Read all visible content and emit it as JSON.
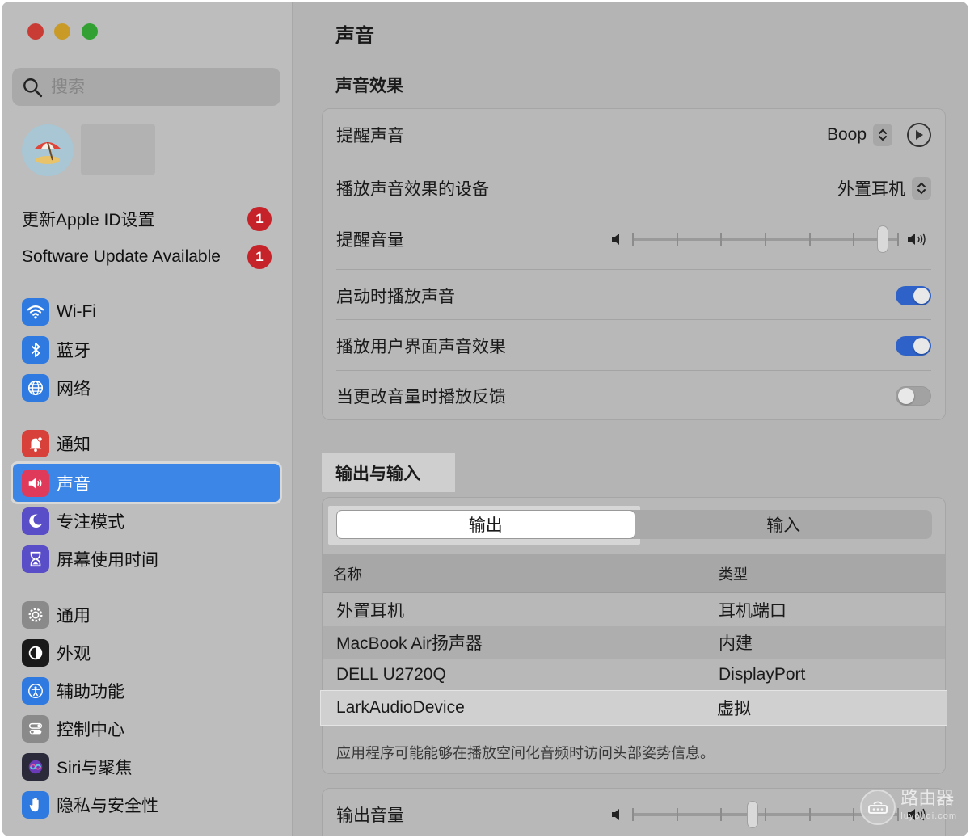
{
  "search": {
    "placeholder": "搜索"
  },
  "sidebar": {
    "updates": [
      {
        "label": "更新Apple ID设置",
        "badge": "1"
      },
      {
        "label": "Software Update Available",
        "badge": "1"
      }
    ],
    "items": [
      {
        "label": "Wi-Fi",
        "icon": "wifi-icon",
        "color": "#2f7ae0"
      },
      {
        "label": "蓝牙",
        "icon": "bluetooth-icon",
        "color": "#2f7ae0"
      },
      {
        "label": "网络",
        "icon": "globe-icon",
        "color": "#2f7ae0"
      },
      {
        "label": "通知",
        "icon": "bell-icon",
        "color": "#d8403a"
      },
      {
        "label": "声音",
        "icon": "speaker-icon",
        "color": "#e03a5a"
      },
      {
        "label": "专注模式",
        "icon": "moon-icon",
        "color": "#5a4ec8"
      },
      {
        "label": "屏幕使用时间",
        "icon": "hourglass-icon",
        "color": "#5a4ec8"
      },
      {
        "label": "通用",
        "icon": "gear-icon",
        "color": "#8a8a8a"
      },
      {
        "label": "外观",
        "icon": "appearance-icon",
        "color": "#1a1a1a"
      },
      {
        "label": "辅助功能",
        "icon": "accessibility-icon",
        "color": "#2f7ae0"
      },
      {
        "label": "控制中心",
        "icon": "control-center-icon",
        "color": "#8a8a8a"
      },
      {
        "label": "Siri与聚焦",
        "icon": "siri-icon",
        "color": "#6a3ab8"
      },
      {
        "label": "隐私与安全性",
        "icon": "hand-icon",
        "color": "#2f7ae0"
      }
    ]
  },
  "main": {
    "title": "声音",
    "sound_effects": {
      "section_title": "声音效果",
      "alert_sound": {
        "label": "提醒声音",
        "value": "Boop"
      },
      "output_device": {
        "label": "播放声音效果的设备",
        "value": "外置耳机"
      },
      "alert_volume": {
        "label": "提醒音量",
        "level": 0.96
      },
      "startup_sound": {
        "label": "启动时播放声音",
        "on": true
      },
      "ui_sound": {
        "label": "播放用户界面声音效果",
        "on": true
      },
      "volume_feedback": {
        "label": "当更改音量时播放反馈",
        "on": false
      }
    },
    "io": {
      "section_title": "输出与输入",
      "tabs": [
        "输出",
        "输入"
      ],
      "selected_tab": "输出",
      "columns": [
        "名称",
        "类型"
      ],
      "devices": [
        {
          "name": "外置耳机",
          "type": "耳机端口"
        },
        {
          "name": "MacBook Air扬声器",
          "type": "内建"
        },
        {
          "name": "DELL U2720Q",
          "type": "DisplayPort"
        },
        {
          "name": "LarkAudioDevice",
          "type": "虚拟"
        }
      ],
      "note": "应用程序可能能够在播放空间化音频时访问头部姿势信息。"
    },
    "output_volume": {
      "label": "输出音量",
      "level": 0.45
    }
  },
  "watermark": {
    "text": "路由器",
    "sub": "luyouqi.com"
  }
}
